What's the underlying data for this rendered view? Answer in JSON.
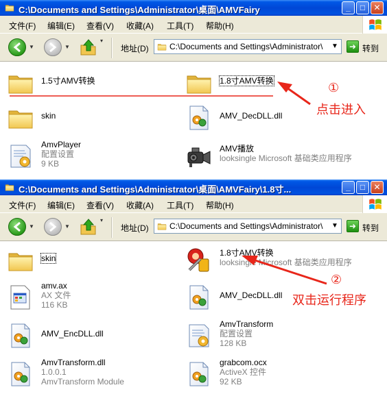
{
  "colors": {
    "annotation": "#e8261a",
    "title_bar": "#0054e3",
    "chrome": "#ece9d8"
  },
  "window1": {
    "title": "C:\\Documents and Settings\\Administrator\\桌面\\AMVFairy",
    "menu": [
      "文件(F)",
      "编辑(E)",
      "查看(V)",
      "收藏(A)",
      "工具(T)",
      "帮助(H)"
    ],
    "address_label": "地址(D)",
    "address": "C:\\Documents and Settings\\Administrator\\",
    "go_label": "转到",
    "items": [
      {
        "icon": "folder-icon",
        "name": "1.5寸AMV转换"
      },
      {
        "icon": "folder-icon",
        "name": "1.8寸AMV转换"
      },
      {
        "icon": "folder-icon",
        "name": "skin"
      },
      {
        "icon": "dll-icon",
        "name": "AMV_DecDLL.dll"
      },
      {
        "icon": "config-file-icon",
        "name": "AmvPlayer",
        "sub1": "配置设置",
        "sub2": "9 KB"
      },
      {
        "icon": "camera-app-icon",
        "name": "AMV播放",
        "sub1": "looksingle Microsoft 基础类应用程序"
      }
    ],
    "annotation_number": "①",
    "annotation_text": "点击进入"
  },
  "window2": {
    "title": "C:\\Documents and Settings\\Administrator\\桌面\\AMVFairy\\1.8寸...",
    "menu": [
      "文件(F)",
      "编辑(E)",
      "查看(V)",
      "收藏(A)",
      "工具(T)",
      "帮助(H)"
    ],
    "address_label": "地址(D)",
    "address": "C:\\Documents and Settings\\Administrator\\",
    "go_label": "转到",
    "items": [
      {
        "icon": "folder-icon",
        "name": "skin"
      },
      {
        "icon": "converter-app-icon",
        "name": "1.8寸AMV转换",
        "sub1": "looksingle Microsoft 基础类应用程序"
      },
      {
        "icon": "ax-file-icon",
        "name": "amv.ax",
        "sub1": "AX 文件",
        "sub2": "116 KB"
      },
      {
        "icon": "dll-icon",
        "name": "AMV_DecDLL.dll"
      },
      {
        "icon": "dll-icon",
        "name": "AMV_EncDLL.dll"
      },
      {
        "icon": "config-file-icon",
        "name": "AmvTransform",
        "sub1": "配置设置",
        "sub2": "128 KB"
      },
      {
        "icon": "dll-icon",
        "name": "AmvTransform.dll",
        "sub1": "1.0.0.1",
        "sub2": "AmvTransform Module"
      },
      {
        "icon": "dll-icon",
        "name": "grabcom.ocx",
        "sub1": "ActiveX 控件",
        "sub2": "92 KB"
      }
    ],
    "annotation_number": "②",
    "annotation_text": "双击运行程序"
  }
}
